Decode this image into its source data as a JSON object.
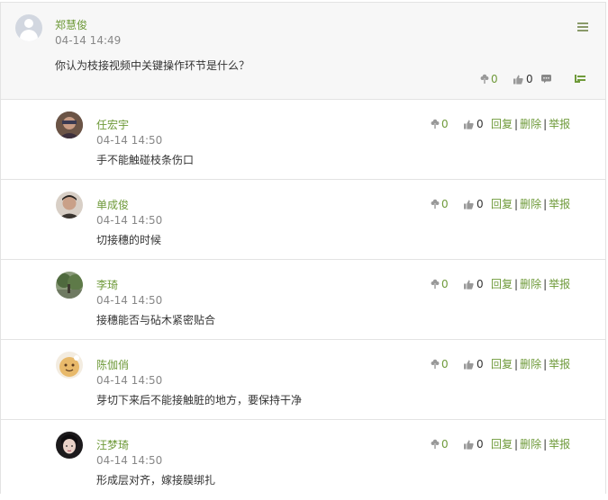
{
  "main": {
    "username": "郑慧俊",
    "time": "04-14 14:49",
    "text": "你认为枝接视频中关键操作环节是什么？",
    "flowers": "0",
    "likes": "0"
  },
  "action_labels": {
    "reply": "回复",
    "delete": "删除",
    "report": "举报",
    "separator": "|"
  },
  "replies": [
    {
      "username": "任宏宇",
      "time": "04-14 14:50",
      "text": "手不能触碰枝条伤口",
      "flowers": "0",
      "likes": "0"
    },
    {
      "username": "单成俊",
      "time": "04-14 14:50",
      "text": "切接穗的时候",
      "flowers": "0",
      "likes": "0"
    },
    {
      "username": "李琦",
      "time": "04-14 14:50",
      "text": "接穗能否与砧木紧密贴合",
      "flowers": "0",
      "likes": "0"
    },
    {
      "username": "陈伽俏",
      "time": "04-14 14:50",
      "text": "芽切下来后不能接触脏的地方，要保持干净",
      "flowers": "0",
      "likes": "0"
    },
    {
      "username": "汪梦琦",
      "time": "04-14 14:50",
      "text": "形成层对齐，嫁接膜绑扎",
      "flowers": "0",
      "likes": "0"
    }
  ],
  "colors": {
    "accent": "#6f9a3a",
    "muted": "#888888",
    "border": "#e3e3e3"
  }
}
